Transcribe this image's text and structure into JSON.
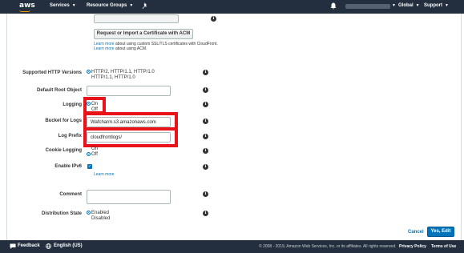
{
  "nav": {
    "logo": "aws",
    "services": "Services",
    "resource_groups": "Resource Groups",
    "global": "Global",
    "support": "Support"
  },
  "certificate": {
    "button": "Request or Import a Certificate with ACM",
    "help1_link": "Learn more",
    "help1_text": " about using custom SSL/TLS certificates with CloudFront.",
    "help2_link": "Learn more",
    "help2_text": " about using ACM."
  },
  "http_versions": {
    "label": "Supported HTTP Versions",
    "option1": "HTTP/2, HTTP/1.1, HTTP/1.0",
    "option2": "HTTP/1.1, HTTP/1.0"
  },
  "default_root": {
    "label": "Default Root Object",
    "value": ""
  },
  "logging": {
    "label": "Logging",
    "on": "On",
    "off": "Off"
  },
  "bucket": {
    "label": "Bucket for Logs",
    "value": "Wafcharm.s3.amazonaws.com"
  },
  "prefix": {
    "label": "Log Prefix",
    "value": "cloudfrontlogs/"
  },
  "cookie_logging": {
    "label": "Cookie Logging",
    "on": "On",
    "off": "Off"
  },
  "ipv6": {
    "label": "Enable IPv6",
    "learn_more": "Learn more"
  },
  "comment": {
    "label": "Comment",
    "value": ""
  },
  "distribution_state": {
    "label": "Distribution State",
    "enabled": "Enabled",
    "disabled": "Disabled"
  },
  "actions": {
    "cancel": "Cancel",
    "submit": "Yes, Edit"
  },
  "footer": {
    "feedback": "Feedback",
    "language": "English (US)",
    "copyright": "© 2008 - 2019, Amazon Web Services, Inc. or its affiliates. All rights reserved.",
    "privacy": "Privacy Policy",
    "terms": "Terms of Use"
  },
  "colors": {
    "nav_bg": "#232f3e",
    "accent": "#0073bb",
    "highlight": "#e8141a",
    "primary_button": "#0073bb"
  },
  "icons": [
    "pin-icon",
    "bell-icon",
    "info-icon",
    "feedback-icon",
    "globe-icon"
  ]
}
